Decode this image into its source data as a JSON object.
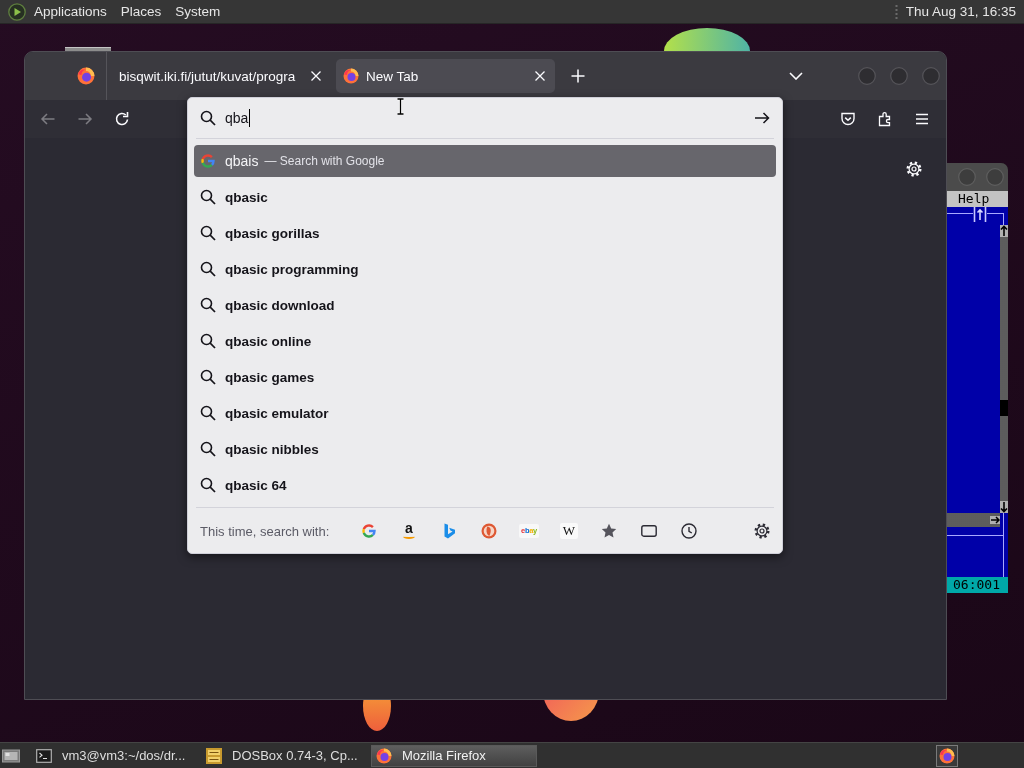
{
  "top_panel": {
    "menus": [
      "Applications",
      "Places",
      "System"
    ],
    "clock": "Thu Aug 31, 16:35"
  },
  "dosbox_window": {
    "menus": [
      "Help"
    ],
    "status": "06:001"
  },
  "browser": {
    "tabs": [
      {
        "kind": "pinned",
        "favicon": true,
        "selected": false
      },
      {
        "kind": "page",
        "favicon": false,
        "title": "bisqwit.iki.fi/jutut/kuvat/progra",
        "selected": false
      },
      {
        "kind": "page",
        "favicon": true,
        "title": "New Tab",
        "selected": true
      }
    ],
    "toolbar": {
      "back": {
        "disabled": true
      },
      "forward": {
        "disabled": true
      }
    },
    "address_bar": {
      "value": "qba"
    },
    "results": [
      {
        "kind": "engine",
        "title": "qbais",
        "action": "— Search with Google",
        "selected": true
      },
      {
        "kind": "suggestion",
        "title": "qbasic",
        "selected": false
      },
      {
        "kind": "suggestion",
        "title": "qbasic gorillas",
        "selected": false
      },
      {
        "kind": "suggestion",
        "title": "qbasic programming",
        "selected": false
      },
      {
        "kind": "suggestion",
        "title": "qbasic download",
        "selected": false
      },
      {
        "kind": "suggestion",
        "title": "qbasic online",
        "selected": false
      },
      {
        "kind": "suggestion",
        "title": "qbasic games",
        "selected": false
      },
      {
        "kind": "suggestion",
        "title": "qbasic emulator",
        "selected": false
      },
      {
        "kind": "suggestion",
        "title": "qbasic nibbles",
        "selected": false
      },
      {
        "kind": "suggestion",
        "title": "qbasic 64",
        "selected": false
      }
    ],
    "one_offs": {
      "label": "This time, search with:",
      "buttons": [
        {
          "kind": "google"
        },
        {
          "kind": "amazon",
          "mark": "a"
        },
        {
          "kind": "bing"
        },
        {
          "kind": "duckduckgo"
        },
        {
          "kind": "ebay",
          "mark": "ebay"
        },
        {
          "kind": "wikipedia",
          "mark": "W"
        },
        {
          "kind": "bookmarks"
        },
        {
          "kind": "tabs"
        },
        {
          "kind": "history"
        }
      ]
    }
  },
  "taskbar": {
    "tasks": [
      {
        "kind": "terminal",
        "title": "vm3@vm3:~/dos/dr...",
        "selected": false
      },
      {
        "kind": "dosbox",
        "title": "DOSBox 0.74-3, Cp...",
        "selected": false
      },
      {
        "kind": "browser",
        "title": "Mozilla Firefox",
        "selected": true
      }
    ]
  }
}
